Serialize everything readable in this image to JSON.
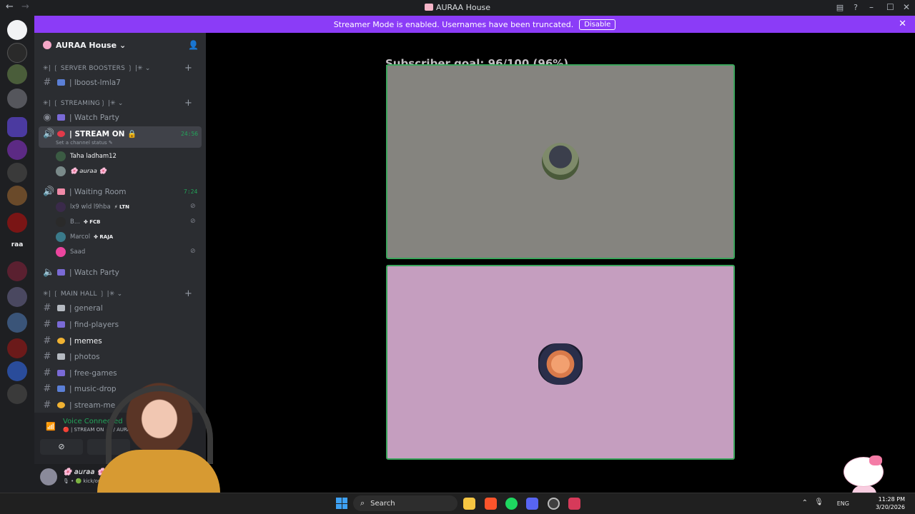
{
  "window": {
    "title": "AURAA House",
    "back": "←",
    "forward": "→",
    "minimize": "–",
    "maximize": "☐",
    "close": "✕"
  },
  "banner": {
    "text": "Streamer Mode is enabled. Usernames have been truncated.",
    "button": "Disable",
    "close": "✕",
    "color": "#8b3cf7"
  },
  "server": {
    "name": "AURAA House",
    "chevron": "⌄",
    "invite_icon": "person-add-icon"
  },
  "rail": {
    "text_item": "raa"
  },
  "categories": {
    "boosters": "✳| ❲ SERVER BOOSTERS ❳ |✳ ⌄",
    "streaming": "✳| ❲ STREAMING❳ |✳ ⌄",
    "main_hall": "✳| ❲ MAIN HALL ❳ |✳ ⌄",
    "plus": "+"
  },
  "channels": {
    "lboost": "| lboost-lmla7",
    "watch_party_stage": "| Watch Party",
    "stream_on": "| STREAM ON 🔒",
    "stream_on_timer": "24:56",
    "stream_on_status": "Set a channel status ✎",
    "waiting_room": "| Waiting Room",
    "waiting_room_timer": "7:24",
    "watch_party_voice": "| Watch Party",
    "general": "| general",
    "find_players": "| find-players",
    "memes": "| memes",
    "photos": "| photos",
    "free_games": "| free-games",
    "music_drop": "| music-drop",
    "stream_me": "| stream-me"
  },
  "stream_members": [
    {
      "name": "Taha ladham12",
      "tag": ""
    },
    {
      "name": "🌸 𝘢𝘶𝘳𝘢𝘢 🌸",
      "tag": ""
    }
  ],
  "waiting_members": [
    {
      "name": "lx9 wld l9hba",
      "tag": "⚡ LTN"
    },
    {
      "name": "B...",
      "tag": "✤ FCB"
    },
    {
      "name": "Marcol",
      "tag": "✤ RAJA"
    },
    {
      "name": "Saad",
      "tag": ""
    }
  ],
  "voice": {
    "status": "Voice Connected",
    "channel": "🔴 | STREAM ON 🔒 / AURAA House",
    "signal_icon": "signal-icon",
    "camera_off": "⊘",
    "screen_share": "⧉"
  },
  "user": {
    "name": "🌸 𝘢𝘶𝘳𝘢𝘢 🌸",
    "status": "🎙 • 🟢 kick/onlyauraa"
  },
  "stage": {
    "goal_text": "Subscriber goal: 96/100 (96%)",
    "goal_current": 96,
    "goal_target": 100,
    "speaking_border": "#3ba55c"
  },
  "taskbar": {
    "search": "Search",
    "search_icon": "⌕",
    "tray_chevron": "⌃",
    "mic": "🎙",
    "lang": "ENG",
    "time": "11:28 PM",
    "date": "3/20/2026"
  }
}
